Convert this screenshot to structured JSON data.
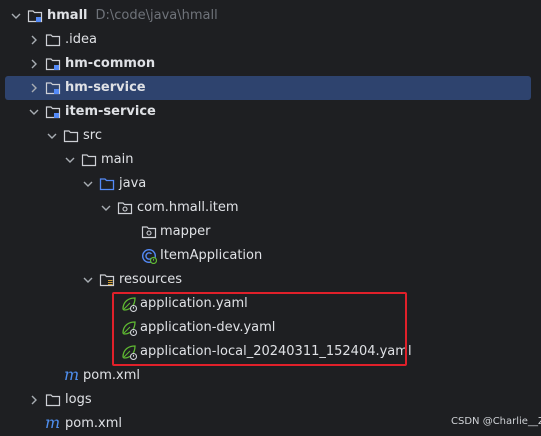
{
  "tree": {
    "root_name": "hmall",
    "root_path": "D:\\code\\java\\hmall",
    "idea": ".idea",
    "hm_common": "hm-common",
    "hm_service": "hm-service",
    "item_service": "item-service",
    "src": "src",
    "main": "main",
    "java": "java",
    "package": "com.hmall.item",
    "mapper": "mapper",
    "item_application": "ItemApplication",
    "resources": "resources",
    "yaml1": "application.yaml",
    "yaml2": "application-dev.yaml",
    "yaml3": "application-local_20240311_152404.yaml",
    "item_pom": "pom.xml",
    "logs": "logs",
    "root_pom": "pom.xml"
  },
  "maven_icon_glyph": "m",
  "watermark": "CSDN @Charlie__ZS",
  "colors": {
    "background": "#1e1f22",
    "selection": "#2e436e",
    "highlight_border": "#e0202a",
    "folder_blue": "#548af7",
    "maven_blue": "#4f8fef",
    "spring_green": "#5fb832"
  }
}
